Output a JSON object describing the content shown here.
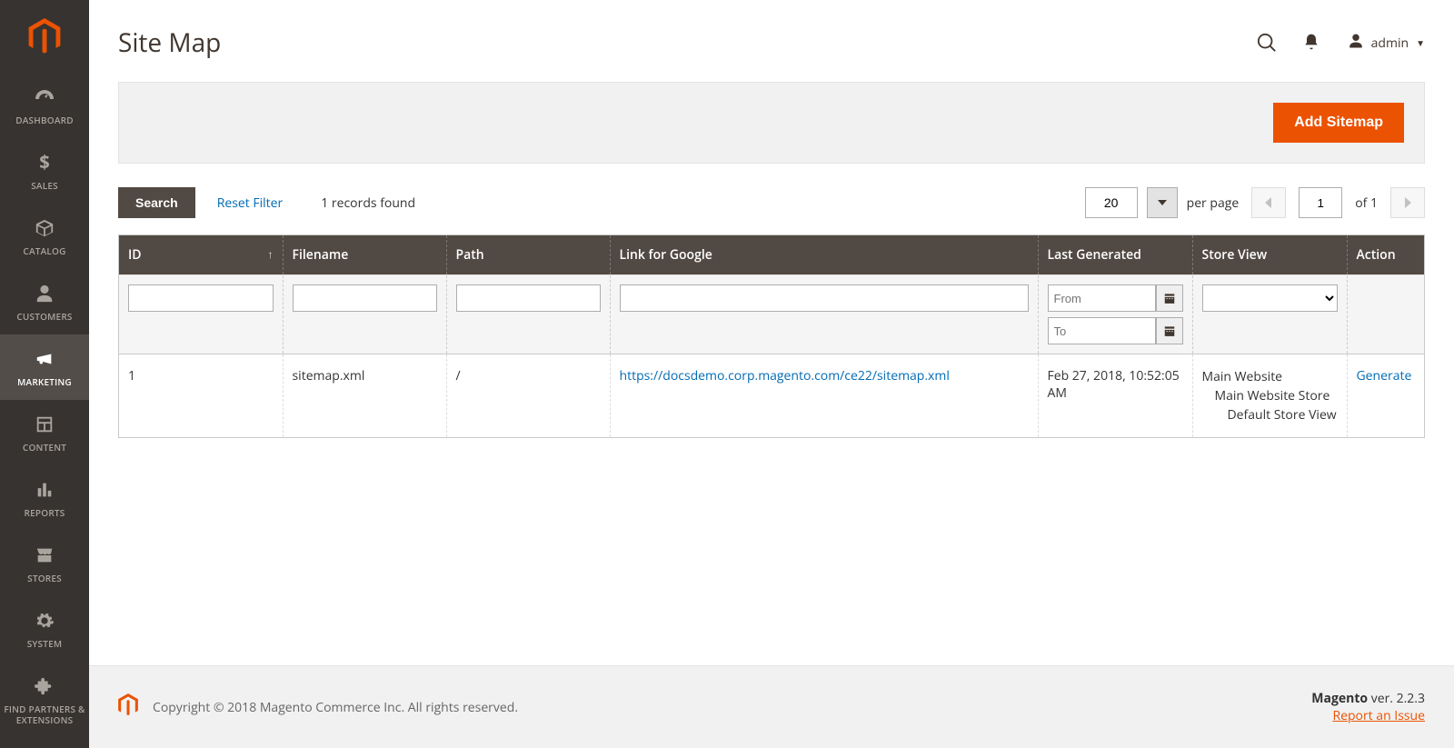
{
  "sidebar": {
    "items": [
      {
        "label": "DASHBOARD"
      },
      {
        "label": "SALES"
      },
      {
        "label": "CATALOG"
      },
      {
        "label": "CUSTOMERS"
      },
      {
        "label": "MARKETING"
      },
      {
        "label": "CONTENT"
      },
      {
        "label": "REPORTS"
      },
      {
        "label": "STORES"
      },
      {
        "label": "SYSTEM"
      },
      {
        "label": "FIND PARTNERS & EXTENSIONS"
      }
    ]
  },
  "header": {
    "title": "Site Map",
    "user": "admin"
  },
  "actions": {
    "add_sitemap": "Add Sitemap"
  },
  "toolbar": {
    "search": "Search",
    "reset": "Reset Filter",
    "records_count": "1",
    "records_label": "records found",
    "per_page_value": "20",
    "per_page_label": "per page",
    "page_current": "1",
    "page_of": "of 1"
  },
  "grid": {
    "columns": {
      "id": "ID",
      "filename": "Filename",
      "path": "Path",
      "link": "Link for Google",
      "last_generated": "Last Generated",
      "store_view": "Store View",
      "action": "Action"
    },
    "filters": {
      "date_from_placeholder": "From",
      "date_to_placeholder": "To"
    },
    "rows": [
      {
        "id": "1",
        "filename": "sitemap.xml",
        "path": "/",
        "link": "https://docsdemo.corp.magento.com/ce22/sitemap.xml",
        "last_generated": "Feb 27, 2018, 10:52:05 AM",
        "store_view_l0": "Main Website",
        "store_view_l1": "Main Website Store",
        "store_view_l2": "Default Store View",
        "action": "Generate"
      }
    ]
  },
  "footer": {
    "copyright": "Copyright © 2018 Magento Commerce Inc. All rights reserved.",
    "product": "Magento",
    "version": " ver. 2.2.3",
    "report": "Report an Issue"
  }
}
